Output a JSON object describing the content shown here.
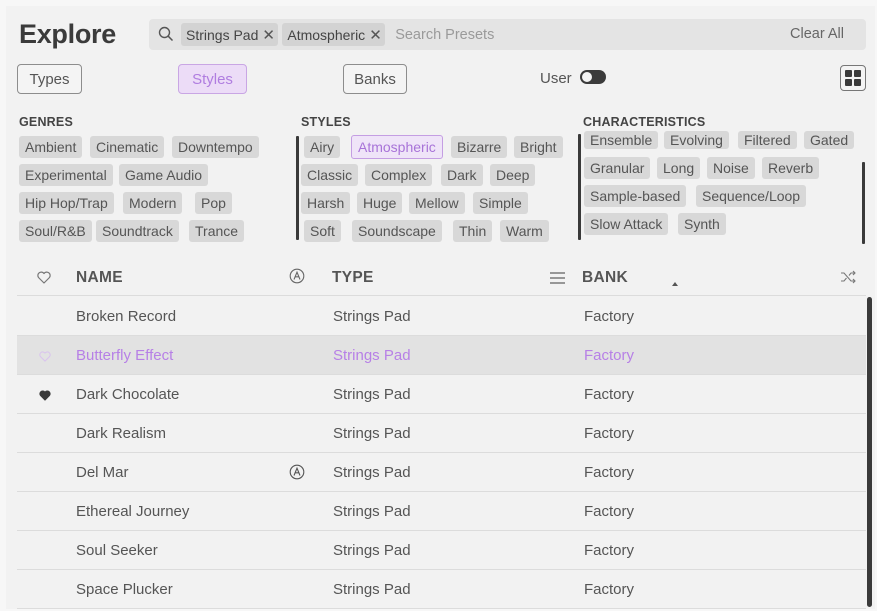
{
  "header": {
    "title": "Explore",
    "search_chips": [
      {
        "label": "Strings Pad",
        "remove": "✕"
      },
      {
        "label": "Atmospheric",
        "remove": "✕"
      }
    ],
    "search_placeholder": "Search Presets",
    "clear_all": "Clear All"
  },
  "toolbar": {
    "types": "Types",
    "styles": "Styles",
    "banks": "Banks",
    "user": "User",
    "user_toggle_on": false,
    "active_tab": "Styles"
  },
  "filters": {
    "genres": {
      "title": "GENRES",
      "items": [
        "Ambient",
        "Cinematic",
        "Downtempo",
        "Experimental",
        "Game Audio",
        "Hip Hop/Trap",
        "Modern",
        "Pop",
        "Soul/R&B",
        "Soundtrack",
        "Trance"
      ]
    },
    "styles": {
      "title": "STYLES",
      "items": [
        "Airy",
        "Atmospheric",
        "Bizarre",
        "Bright",
        "Classic",
        "Complex",
        "Dark",
        "Deep",
        "Harsh",
        "Huge",
        "Mellow",
        "Simple",
        "Soft",
        "Soundscape",
        "Thin",
        "Warm"
      ],
      "selected": "Atmospheric"
    },
    "characteristics": {
      "title": "CHARACTERISTICS",
      "items": [
        "Ensemble",
        "Evolving",
        "Filtered",
        "Gated",
        "Granular",
        "Long",
        "Noise",
        "Reverb",
        "Sample-based",
        "Sequence/Loop",
        "Slow Attack",
        "Synth"
      ]
    }
  },
  "table": {
    "columns": {
      "name": "NAME",
      "type": "TYPE",
      "bank": "BANK"
    },
    "sort_column": "BANK",
    "sort_direction": "ascending",
    "rows": [
      {
        "name": "Broken Record",
        "type": "Strings Pad",
        "bank": "Factory",
        "liked": false,
        "author_icon": false,
        "highlighted": false
      },
      {
        "name": "Butterfly Effect",
        "type": "Strings Pad",
        "bank": "Factory",
        "liked": false,
        "author_icon": false,
        "highlighted": true
      },
      {
        "name": "Dark Chocolate",
        "type": "Strings Pad",
        "bank": "Factory",
        "liked": true,
        "author_icon": false,
        "highlighted": false
      },
      {
        "name": "Dark Realism",
        "type": "Strings Pad",
        "bank": "Factory",
        "liked": false,
        "author_icon": false,
        "highlighted": false
      },
      {
        "name": "Del Mar",
        "type": "Strings Pad",
        "bank": "Factory",
        "liked": false,
        "author_icon": true,
        "highlighted": false
      },
      {
        "name": "Ethereal Journey",
        "type": "Strings Pad",
        "bank": "Factory",
        "liked": false,
        "author_icon": false,
        "highlighted": false
      },
      {
        "name": "Soul Seeker",
        "type": "Strings Pad",
        "bank": "Factory",
        "liked": false,
        "author_icon": false,
        "highlighted": false
      },
      {
        "name": "Space Plucker",
        "type": "Strings Pad",
        "bank": "Factory",
        "liked": false,
        "author_icon": false,
        "highlighted": false
      }
    ]
  },
  "colors": {
    "accent": "#b07de0",
    "text": "#3a3a3a",
    "background": "#f2f2f2"
  }
}
